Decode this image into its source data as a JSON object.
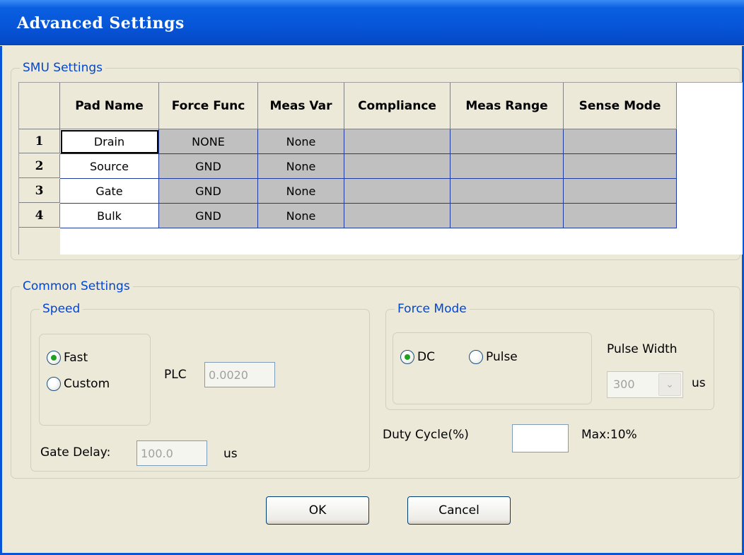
{
  "window": {
    "title": "Advanced Settings"
  },
  "smu": {
    "legend": "SMU Settings",
    "columns": [
      "Pad Name",
      "Force Func",
      "Meas Var",
      "Compliance",
      "Meas Range",
      "Sense Mode"
    ],
    "rows": [
      {
        "num": "1",
        "pad": "Drain",
        "force": "NONE",
        "meas": "None",
        "compliance": "",
        "range": "",
        "sense": ""
      },
      {
        "num": "2",
        "pad": "Source",
        "force": "GND",
        "meas": "None",
        "compliance": "",
        "range": "",
        "sense": ""
      },
      {
        "num": "3",
        "pad": "Gate",
        "force": "GND",
        "meas": "None",
        "compliance": "",
        "range": "",
        "sense": ""
      },
      {
        "num": "4",
        "pad": "Bulk",
        "force": "GND",
        "meas": "None",
        "compliance": "",
        "range": "",
        "sense": ""
      }
    ]
  },
  "common": {
    "legend": "Common Settings",
    "speed": {
      "legend": "Speed",
      "options": [
        "Fast",
        "Custom"
      ],
      "selected": "Fast",
      "plc_label": "PLC",
      "plc_value": "0.0020",
      "gate_delay_label": "Gate Delay:",
      "gate_delay_value": "100.0",
      "gate_delay_unit": "us"
    },
    "force_mode": {
      "legend": "Force Mode",
      "options": [
        "DC",
        "Pulse"
      ],
      "selected": "DC",
      "pulse_width_label": "Pulse Width",
      "pulse_width_value": "300",
      "pulse_width_unit": "us"
    },
    "duty_cycle": {
      "label": "Duty Cycle(%)",
      "value": "",
      "max": "Max:10%"
    }
  },
  "buttons": {
    "ok": "OK",
    "cancel": "Cancel"
  },
  "icons": {
    "radio_selected_color": "#21a121",
    "combo_arrow": "chevron-down-icon"
  },
  "colors": {
    "titlebar": "#0755d8",
    "group_legend": "#0046d5",
    "grid_line": "#1f3aa0",
    "gray_cell": "#c0c0c0"
  }
}
